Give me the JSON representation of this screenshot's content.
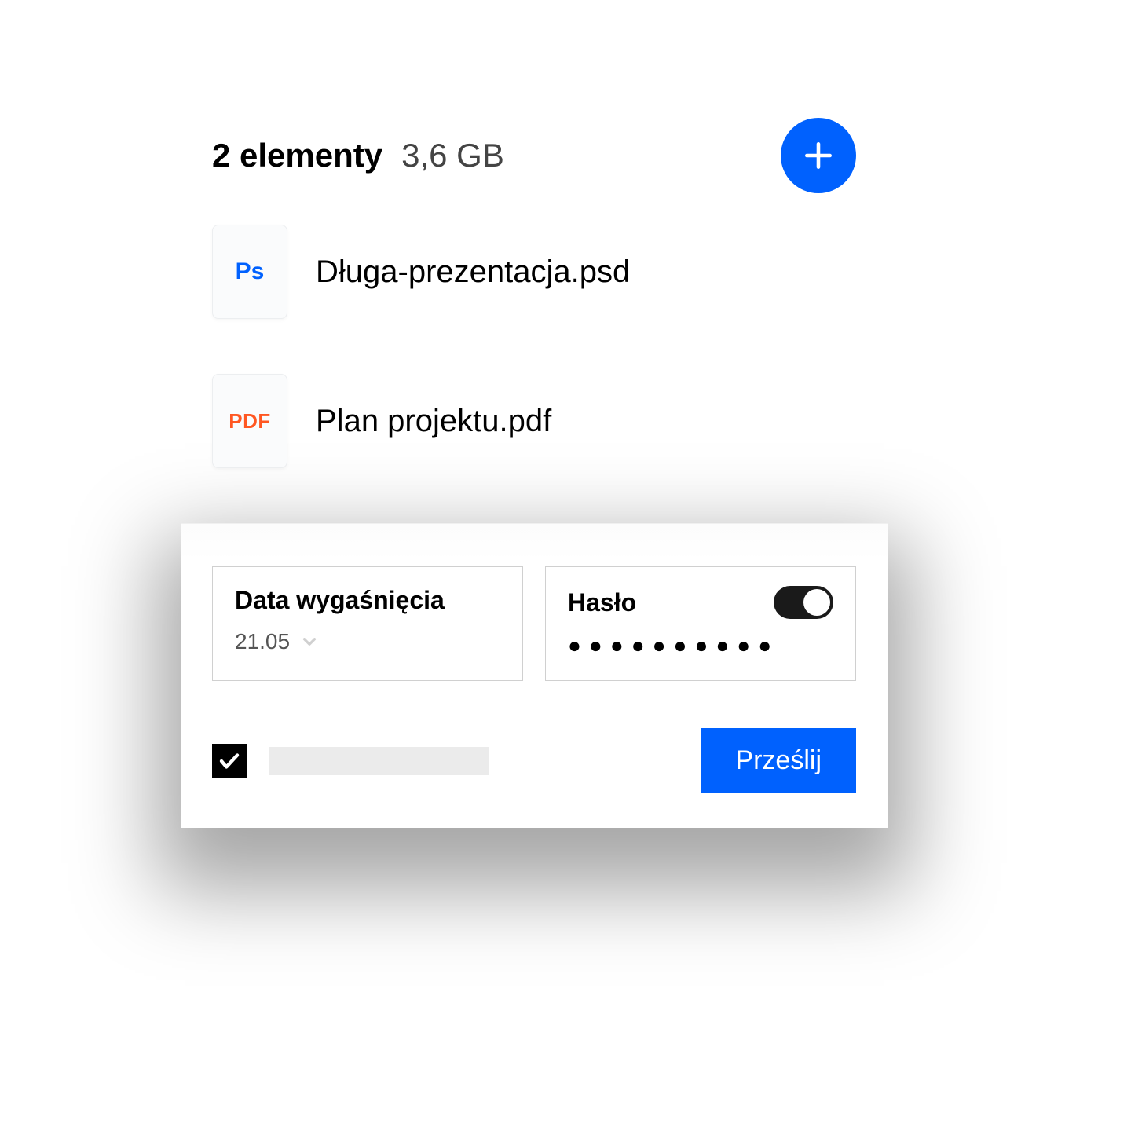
{
  "header": {
    "item_count": "2 elementy",
    "total_size": "3,6 GB"
  },
  "files": [
    {
      "icon_label": "Ps",
      "icon_type": "ps",
      "name": "Długa-prezentacja.psd"
    },
    {
      "icon_label": "PDF",
      "icon_type": "pdf",
      "name": "Plan projektu.pdf"
    }
  ],
  "options": {
    "expiration": {
      "label": "Data wygaśnięcia",
      "value": "21.05"
    },
    "password": {
      "label": "Hasło",
      "masked": "●●●●●●●●●●",
      "enabled": true
    }
  },
  "actions": {
    "submit_label": "Prześlij"
  }
}
